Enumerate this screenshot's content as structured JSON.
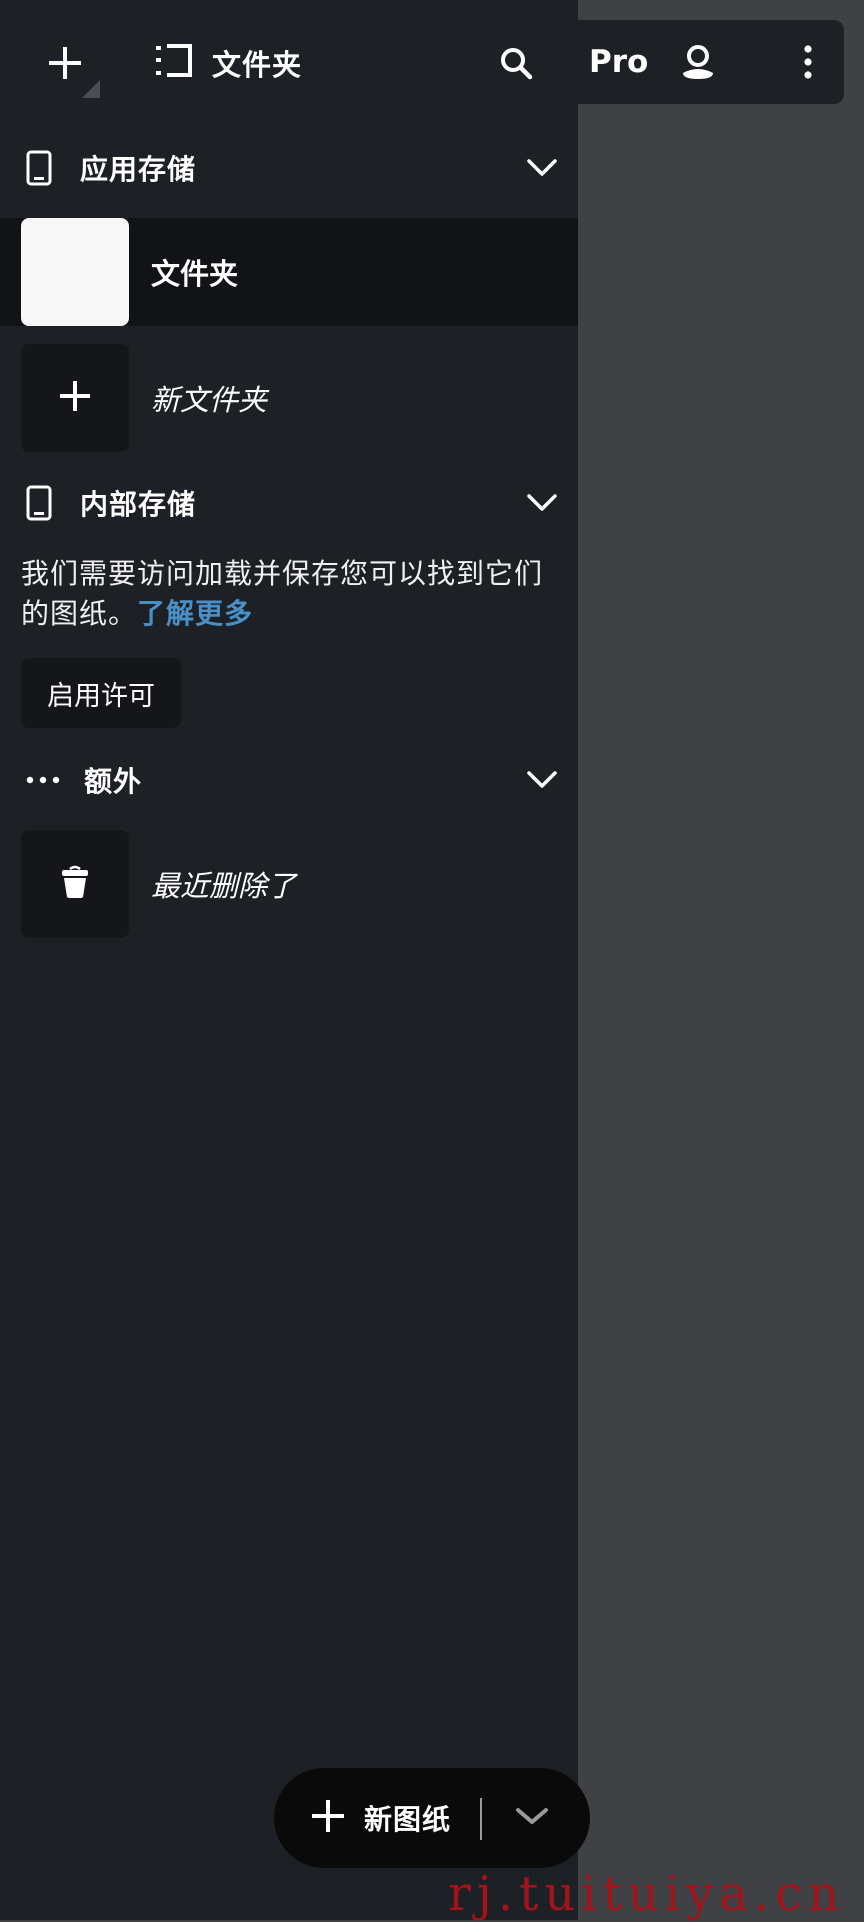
{
  "header": {
    "title": "文件夹",
    "icons": {
      "add": "plus-icon",
      "folder": "folder-view-icon",
      "search": "search-icon"
    }
  },
  "toolbar": {
    "pro_label": "Pro",
    "icons": {
      "account": "account-icon",
      "more": "more-vertical-icon"
    }
  },
  "sections": {
    "app_storage": {
      "label": "应用存储",
      "icon": "phone-icon",
      "items": [
        {
          "label": "文件夹",
          "selected": true
        },
        {
          "label": "新文件夹",
          "icon": "plus-icon"
        }
      ]
    },
    "internal_storage": {
      "label": "内部存储",
      "icon": "phone-icon",
      "message": "我们需要访问加载并保存您可以找到它们的图纸。",
      "link": "了解更多",
      "button": "启用许可"
    },
    "extra": {
      "label": "额外",
      "icon": "more-horizontal-icon",
      "items": [
        {
          "label": "最近删除了",
          "icon": "trash-icon"
        }
      ]
    }
  },
  "fab": {
    "label": "新图纸",
    "icon": "plus-icon",
    "dropdown_icon": "chevron-down-icon"
  },
  "watermark": "rj.tuituiya.cn",
  "colors": {
    "drawer_bg": "#1d2024",
    "page_bg": "#3f4144",
    "selected_row": "#111316",
    "tile_bg": "#141619",
    "link": "#4a90c8",
    "watermark": "#a1141a"
  }
}
